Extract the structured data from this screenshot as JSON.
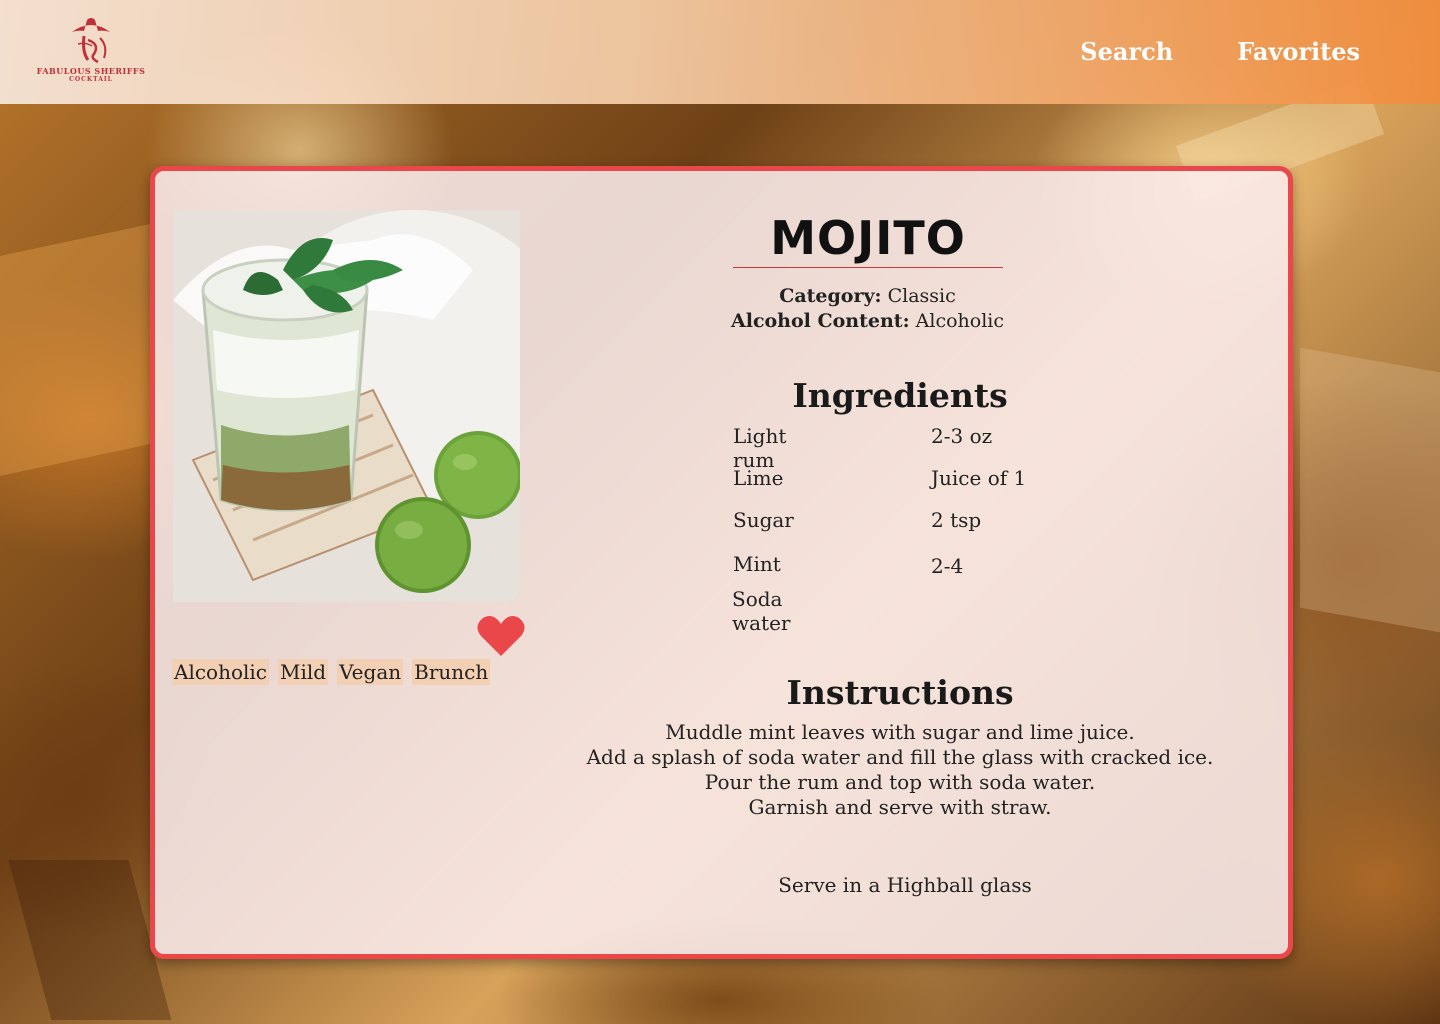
{
  "brand": {
    "logo_line1": "FABULOUS SHERIFFS",
    "logo_line2": "COCKTAIL",
    "accent_color": "#e9474a"
  },
  "nav": {
    "search_label": "Search",
    "favorites_label": "Favorites"
  },
  "drink": {
    "name": "MOJITO",
    "category_label": "Category:",
    "category": "Classic",
    "alcohol_label": "Alcohol Content:",
    "alcohol": "Alcoholic",
    "tags": [
      "Alcoholic",
      "Mild",
      "Vegan",
      "Brunch"
    ],
    "favorite": true,
    "ingredients_heading": "Ingredients",
    "ingredients": [
      {
        "name": "Light rum",
        "qty": "2-3 oz"
      },
      {
        "name": "Lime",
        "qty": "Juice of 1"
      },
      {
        "name": "Sugar",
        "qty": "2 tsp"
      },
      {
        "name": "Mint",
        "qty": "2-4"
      },
      {
        "name": "Soda water",
        "qty": ""
      }
    ],
    "instructions_heading": "Instructions",
    "instructions": [
      "Muddle mint leaves with sugar and lime juice.",
      "Add a splash of soda water and fill the glass with cracked ice.",
      "Pour the rum and top with soda water.",
      "Garnish and serve with straw."
    ],
    "glass_text": "Serve in a Highball glass"
  },
  "icons": {
    "heart": "heart-icon",
    "logo": "sheriff-hat-logo"
  }
}
